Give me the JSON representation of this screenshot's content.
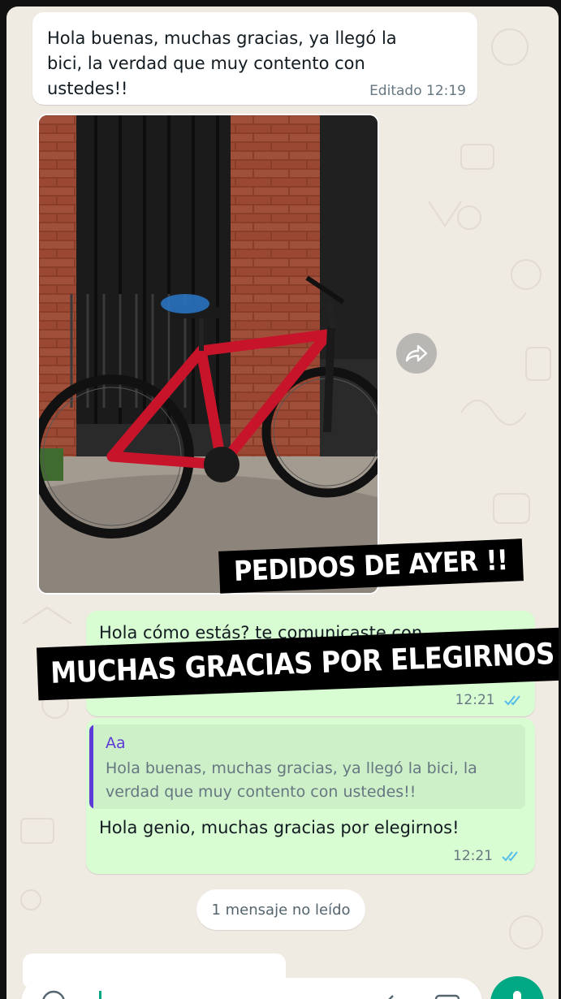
{
  "messages": {
    "incoming_1": {
      "text": "Hola buenas, muchas gracias, ya llegó la bici, la verdad que muy contento con ustedes!!",
      "meta": "Editado 12:19"
    },
    "outgoing_1": {
      "text": "Hola cómo estás? te comunicaste con",
      "time": "12:21"
    },
    "outgoing_2": {
      "quote_author": "Aa",
      "quote_text": "Hola buenas, muchas gracias, ya llegó la bici, la verdad que muy contento con ustedes!!",
      "text": "Hola genio, muchas gracias por elegirnos!",
      "time": "12:21"
    }
  },
  "stickers": {
    "top": "PEDIDOS DE AYER !!",
    "bottom": "MUCHAS GRACIAS POR ELEGIRNOS"
  },
  "unread_label": "1 mensaje no leído",
  "icons": {
    "forward": "forward-arrow-icon",
    "read_ticks": "double-check-icon",
    "check_emoji": "check-mark-emoji-icon",
    "emoji": "emoji-icon",
    "attach": "paperclip-icon",
    "camera": "camera-icon",
    "mic": "mic-icon"
  },
  "colors": {
    "chat_background": "#efeae2",
    "incoming_bubble": "#ffffff",
    "outgoing_bubble": "#d9fdd3",
    "read_ticks": "#53bdeb",
    "accent_green": "#00a884",
    "quote_author": "#5e3ad6",
    "sticker_background": "#000000"
  }
}
